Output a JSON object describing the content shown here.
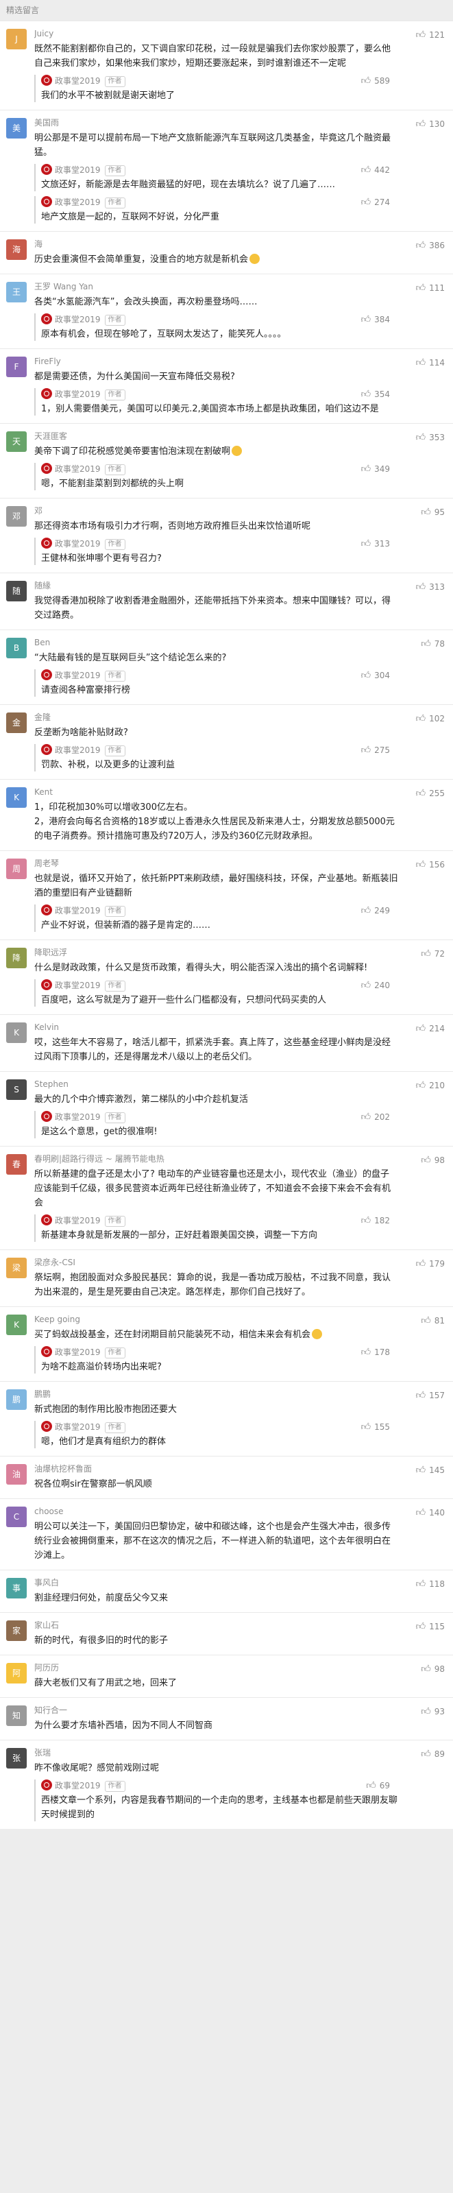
{
  "section_title": "精选留言",
  "reply_tag": "作者",
  "emoji_icon": "smile-emoji-icon",
  "comments": [
    {
      "name": "Juicy",
      "likes": "121",
      "avatar_color": "#e8a94b",
      "avatar_text": "J",
      "text": "既然不能割割都你自己的，又下调自家印花税，过一段就是骗我们去你家炒股票了，要么他自己来我们家炒，如果他来我们家炒，短期还要涨起来，到时谁割谁还不一定呢",
      "reply": {
        "name": "政事堂2019",
        "likes": "589",
        "text": "我们的水平不被割就是谢天谢地了"
      }
    },
    {
      "name": "美国雨",
      "likes": "130",
      "avatar_color": "#5b8fd6",
      "avatar_text": "美",
      "text": "明公那是不是可以提前布局一下地产文旅新能源汽车互联网这几类基金，毕竟这几个融资最猛。",
      "replies": [
        {
          "name": "政事堂2019",
          "likes": "442",
          "text": "文旅还好，新能源是去年融资最猛的好吧，现在去填坑么？说了几遍了……"
        },
        {
          "name": "政事堂2019",
          "likes": "274",
          "text": "地产文旅是一起的，互联网不好说，分化严重"
        }
      ]
    },
    {
      "name": "海",
      "likes": "386",
      "avatar_color": "#c85a4a",
      "avatar_text": "海",
      "text": "历史会重演但不会简单重复，没重合的地方就是新机会",
      "emoji": true
    },
    {
      "name": "王罗 Wang Yan",
      "likes": "111",
      "avatar_color": "#7fb6e0",
      "avatar_text": "王",
      "text": "各类“水氢能源汽车”，会改头换面，再次粉墨登场吗……",
      "reply": {
        "name": "政事堂2019",
        "likes": "384",
        "text": "原本有机会，但现在够呛了，互联网太发达了，能笑死人。。。。"
      }
    },
    {
      "name": "FireFly",
      "likes": "114",
      "avatar_color": "#8c6bb5",
      "avatar_text": "F",
      "text": "都是需要还债，为什么美国间一天宣布降低交易税?",
      "reply": {
        "name": "政事堂2019",
        "likes": "354",
        "text": "1，别人需要借美元，美国可以印美元.2,美国资本市场上都是执政集团，咱们这边不是"
      }
    },
    {
      "name": "天涯匪客",
      "likes": "353",
      "avatar_color": "#68a46a",
      "avatar_text": "天",
      "text": "美帝下调了印花税感觉美帝要害怕泡沫现在割破啊",
      "emoji": true,
      "reply": {
        "name": "政事堂2019",
        "likes": "349",
        "text": "嗯，不能割韭菜割到刘都统的头上啊"
      }
    },
    {
      "name": "邓",
      "likes": "95",
      "avatar_color": "#9a9a9a",
      "avatar_text": "邓",
      "text": "那还得资本市场有吸引力才行啊，否则地方政府推巨头出来饮恰道听呢",
      "reply": {
        "name": "政事堂2019",
        "likes": "313",
        "text": "王健林和张坤哪个更有号召力?"
      }
    },
    {
      "name": "随緣",
      "likes": "313",
      "avatar_color": "#4a4a4a",
      "avatar_text": "随",
      "text": "我觉得香港加税除了收割香港金融圈外，还能带抵挡下外来资本。想来中国赚钱？可以，得交过路费。"
    },
    {
      "name": "Ben",
      "likes": "78",
      "avatar_color": "#4aa3a0",
      "avatar_text": "B",
      "text": "“大陆最有钱的是互联网巨头”这个结论怎么来的?",
      "reply": {
        "name": "政事堂2019",
        "likes": "304",
        "text": "请查阅各种富豪排行榜"
      }
    },
    {
      "name": "金隆",
      "likes": "102",
      "avatar_color": "#8d6b4e",
      "avatar_text": "金",
      "text": "反垄断为啥能补贴财政?",
      "reply": {
        "name": "政事堂2019",
        "likes": "275",
        "text": "罚款、补税，以及更多的让渡利益"
      }
    },
    {
      "name": "Kent",
      "likes": "255",
      "avatar_color": "#5b8fd6",
      "avatar_text": "K",
      "text": "1，印花税加30%可以增收300亿左右。\n2，港府会向每名合资格的18岁或以上香港永久性居民及新来港人士，分期发放总额5000元的电子消费券。预计措施可惠及约720万人，涉及约360亿元财政承担。"
    },
    {
      "name": "周老琴",
      "likes": "156",
      "avatar_color": "#d9809a",
      "avatar_text": "周",
      "text": "也就是说，循环又开始了，依托新PPT来刷政绩，最好围绕科技，环保，产业基地。新瓶装旧酒的重塑旧有产业链翻新",
      "reply": {
        "name": "政事堂2019",
        "likes": "249",
        "text": "产业不好说，但装新酒的器子是肯定的……"
      }
    },
    {
      "name": "降职远浮",
      "likes": "72",
      "avatar_color": "#8f9a4a",
      "avatar_text": "降",
      "text": "什么是财政政策，什么又是货币政策，看得头大，明公能否深入浅出的搞个名词解释!",
      "reply": {
        "name": "政事堂2019",
        "likes": "240",
        "text": "百度吧，这么写就是为了避开一些什么门槛都没有，只想问代码买卖的人"
      }
    },
    {
      "name": "Kelvin",
      "likes": "214",
      "avatar_color": "#9a9a9a",
      "avatar_text": "K",
      "text": "哎，这些年大不容易了，啥活儿都干，抓紧洗手套。真上阵了，这些基金经理小鲜肉是没经过风雨下顶事儿的，还是得屠龙术八级以上的老岳父们。"
    },
    {
      "name": "Stephen",
      "likes": "210",
      "avatar_color": "#4a4a4a",
      "avatar_text": "S",
      "text": "最大的几个中介博弈激烈，第二梯队的小中介趁机复活",
      "reply": {
        "name": "政事堂2019",
        "likes": "202",
        "text": "是这么个意思，get的很准啊!"
      }
    },
    {
      "name": "春明刷|超路行得远 ~ 屠腾节能电热",
      "likes": "98",
      "avatar_color": "#c85a4a",
      "avatar_text": "春",
      "text": "所以新基建的盘子还是太小了? 电动车的产业链容量也还是太小，现代农业（渔业）的盘子应该能到千亿级，很多民营资本近两年已经往新渔业砖了，不知道会不会接下来会不会有机会",
      "reply": {
        "name": "政事堂2019",
        "likes": "182",
        "text": "新基建本身就是新发展的一部分，正好赶着跟美国交换，调整一下方向"
      }
    },
    {
      "name": "梁彦永-CSI",
      "likes": "179",
      "avatar_color": "#e8a94b",
      "avatar_text": "梁",
      "text": "祭坛啊，抱团股面对众多股民基民：算命的说，我是一香功成万股枯，不过我不同意，我认为出来混的，是生是死要由自己决定。路怎样走，那你们自己找好了。"
    },
    {
      "name": "Keep going",
      "likes": "81",
      "avatar_color": "#68a46a",
      "avatar_text": "K",
      "text": "买了蚂蚁战投基金，还在封闭期目前只能装死不动，相信未来会有机会",
      "emoji": true,
      "reply": {
        "name": "政事堂2019",
        "likes": "178",
        "text": "为啥不趁高溢价转场内出来呢?"
      }
    },
    {
      "name": "鹏鹏",
      "likes": "157",
      "avatar_color": "#7fb6e0",
      "avatar_text": "鹏",
      "text": "新式抱团的制作用比股市抱团还要大",
      "reply": {
        "name": "政事堂2019",
        "likes": "155",
        "text": "嗯，他们才是真有组织力的群体"
      }
    },
    {
      "name": "油爆杭挖杯鲁面",
      "likes": "145",
      "avatar_color": "#d9809a",
      "avatar_text": "油",
      "text": "祝各位啊sir在警察部一帆风顺"
    },
    {
      "name": "choose",
      "likes": "140",
      "avatar_color": "#8c6bb5",
      "avatar_text": "C",
      "text": "明公可以关注一下，美国回归巴黎协定，破中和碳达峰，这个也是会产生强大冲击，很多传统行业会被拥倒重来，那不在这次的情况之后，不一样进入新的轨道吧，这个去年很明白在沙滩上。"
    },
    {
      "name": "事风白",
      "likes": "118",
      "avatar_color": "#4aa3a0",
      "avatar_text": "事",
      "text": "割韭经理归何处，前度岳父今又来"
    },
    {
      "name": "家山石",
      "likes": "115",
      "avatar_color": "#8d6b4e",
      "avatar_text": "家",
      "text": "新的时代，有很多旧的时代的影子"
    },
    {
      "name": "阿历历",
      "likes": "98",
      "avatar_color": "#f5c23b",
      "avatar_text": "阿",
      "text": "薛大老板们又有了用武之地，回来了"
    },
    {
      "name": "知行合一",
      "likes": "93",
      "avatar_color": "#9a9a9a",
      "avatar_text": "知",
      "text": "为什么要才东墙补西墙，因为不同人不同智商"
    },
    {
      "name": "张瑞",
      "likes": "89",
      "avatar_color": "#4a4a4a",
      "avatar_text": "张",
      "text": "昨不像收尾呢？感觉前戏刚过呢",
      "reply": {
        "name": "政事堂2019",
        "likes": "69",
        "text": "西楼文章一个系列，内容是我春节期间的一个走向的思考，主线基本也都是前些天跟朋友聊天时候提到的"
      }
    }
  ]
}
